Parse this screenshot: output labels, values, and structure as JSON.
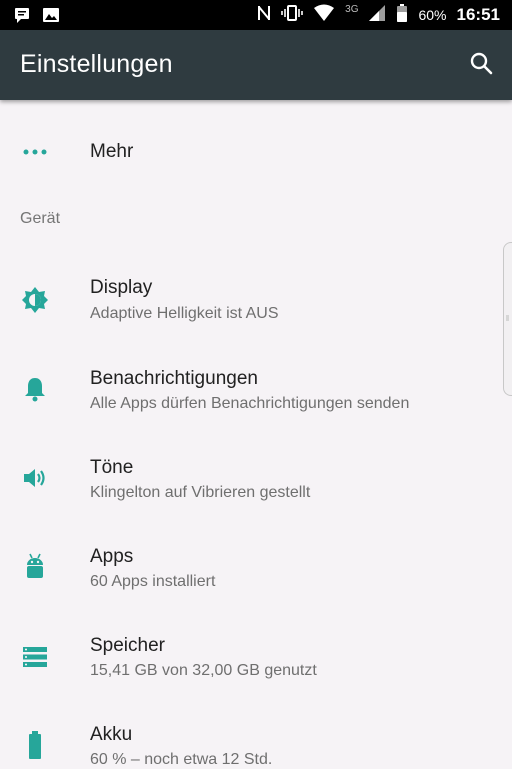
{
  "status_bar": {
    "battery_percent": "60%",
    "time": "16:51",
    "network": "3G",
    "icons": [
      "notification-icon",
      "image-icon",
      "nfc-icon",
      "vibrate-icon",
      "wifi-icon",
      "signal-icon",
      "battery-icon"
    ]
  },
  "appbar": {
    "title": "Einstellungen",
    "search_icon": "search-icon"
  },
  "items": {
    "mehr": {
      "title": "Mehr",
      "icon": "more-horiz-icon"
    },
    "section_geraet": "Gerät",
    "display": {
      "title": "Display",
      "subtitle": "Adaptive Helligkeit ist AUS",
      "icon": "brightness-icon"
    },
    "notifications": {
      "title": "Benachrichtigungen",
      "subtitle": "Alle Apps dürfen Benachrichtigungen senden",
      "icon": "bell-icon"
    },
    "sounds": {
      "title": "Töne",
      "subtitle": "Klingelton auf Vibrieren gestellt",
      "icon": "volume-icon"
    },
    "apps": {
      "title": "Apps",
      "subtitle": "60 Apps installiert",
      "icon": "android-icon"
    },
    "storage": {
      "title": "Speicher",
      "subtitle": "15,41 GB von 32,00 GB genutzt",
      "icon": "storage-icon"
    },
    "battery": {
      "title": "Akku",
      "subtitle": "60 % – noch etwa 12 Std.",
      "icon": "battery-icon"
    }
  },
  "colors": {
    "accent": "#26a69a",
    "appbar": "#2f3b40",
    "background": "#f6f3f6"
  }
}
